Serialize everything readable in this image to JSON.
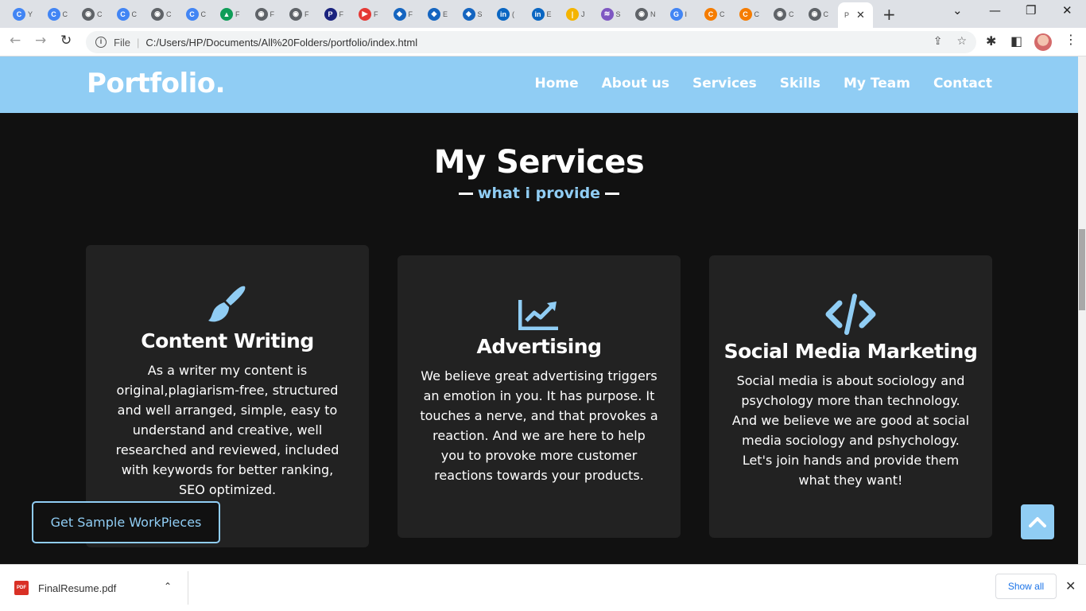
{
  "browser": {
    "tabs": [
      {
        "label": "Y",
        "color": "#4285f4",
        "glyph": "C"
      },
      {
        "label": "C",
        "color": "#4285f4",
        "glyph": "C"
      },
      {
        "label": "C",
        "color": "#5f6368",
        "glyph": "◉"
      },
      {
        "label": "C",
        "color": "#4285f4",
        "glyph": "C"
      },
      {
        "label": "C",
        "color": "#5f6368",
        "glyph": "◉"
      },
      {
        "label": "C",
        "color": "#4285f4",
        "glyph": "C"
      },
      {
        "label": "F",
        "color": "#0f9d58",
        "glyph": "▲"
      },
      {
        "label": "F",
        "color": "#5f6368",
        "glyph": "◉"
      },
      {
        "label": "F",
        "color": "#5f6368",
        "glyph": "◉"
      },
      {
        "label": "F",
        "color": "#1a237e",
        "glyph": "P"
      },
      {
        "label": "F",
        "color": "#e53935",
        "glyph": "▶"
      },
      {
        "label": "F",
        "color": "#1565c0",
        "glyph": "◆"
      },
      {
        "label": "E",
        "color": "#1565c0",
        "glyph": "◆"
      },
      {
        "label": "S",
        "color": "#1565c0",
        "glyph": "◆"
      },
      {
        "label": "(",
        "color": "#0a66c2",
        "glyph": "in"
      },
      {
        "label": "E",
        "color": "#0a66c2",
        "glyph": "in"
      },
      {
        "label": "J",
        "color": "#f4b400",
        "glyph": "|"
      },
      {
        "label": "S",
        "color": "#7e57c2",
        "glyph": "≋"
      },
      {
        "label": "N",
        "color": "#5f6368",
        "glyph": "◉"
      },
      {
        "label": "I",
        "color": "#4285f4",
        "glyph": "G"
      },
      {
        "label": "C",
        "color": "#f57c00",
        "glyph": "C"
      },
      {
        "label": "C",
        "color": "#f57c00",
        "glyph": "C"
      },
      {
        "label": "C",
        "color": "#5f6368",
        "glyph": "◉"
      },
      {
        "label": "C",
        "color": "#5f6368",
        "glyph": "◉"
      }
    ],
    "active_tab": {
      "label": "P"
    },
    "file_label": "File",
    "url": "C:/Users/HP/Documents/All%20Folders/portfolio/index.html"
  },
  "site": {
    "logo": "Portfolio.",
    "nav": [
      "Home",
      "About us",
      "Services",
      "Skills",
      "My Team",
      "Contact"
    ],
    "section_title": "My Services",
    "section_subtitle": "what i provide",
    "services": [
      {
        "icon": "paintbrush-icon",
        "title": "Content Writing",
        "text": "As a writer my content is original,plagiarism-free, structured and well arranged, simple, easy to understand and creative, well researched and reviewed, included with keywords for better ranking, SEO optimized."
      },
      {
        "icon": "chart-line-icon",
        "title": "Advertising",
        "text": "We believe great advertising triggers an emotion in you. It has purpose. It touches a nerve, and that provokes a reaction. And we are here to help you to provoke more customer reactions towards your products."
      },
      {
        "icon": "code-icon",
        "title": "Social Media Marketing",
        "text": "Social media is about sociology and psychology more than technology. And we believe we are good at social media sociology and pshychology. Let's join hands and provide them what they want!"
      }
    ],
    "sample_button": "Get Sample WorkPieces",
    "accent": "#90cdf4"
  },
  "downloads": {
    "file": "FinalResume.pdf",
    "file_badge": "PDF",
    "show_all": "Show all"
  }
}
